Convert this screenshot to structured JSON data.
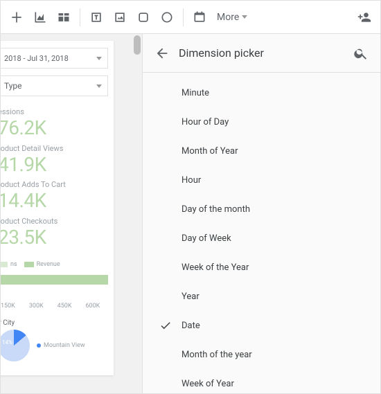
{
  "toolbar": {
    "more_label": "More"
  },
  "report": {
    "date_range": "2018 - Jul 31, 2018",
    "type_label": "Type",
    "metrics": [
      {
        "label": "essions",
        "value": "76.2K"
      },
      {
        "label": "roduct Detail Views",
        "value": "41.9K"
      },
      {
        "label": "roduct Adds To Cart",
        "value": "14.4K"
      },
      {
        "label": "roduct Checkouts",
        "value": "23.5K"
      }
    ],
    "legend": [
      "ns",
      "Revenue"
    ],
    "axis": [
      "150K",
      "300K",
      "450K",
      "600K"
    ],
    "subtitle": "y City",
    "pie_label": "14%",
    "pie_legend": "Mountain View"
  },
  "panel": {
    "title": "Dimension picker",
    "items": [
      {
        "label": "Minute",
        "selected": false
      },
      {
        "label": "Hour of Day",
        "selected": false
      },
      {
        "label": "Month of Year",
        "selected": false
      },
      {
        "label": "Hour",
        "selected": false
      },
      {
        "label": "Day of the month",
        "selected": false
      },
      {
        "label": "Day of Week",
        "selected": false
      },
      {
        "label": "Week of the Year",
        "selected": false
      },
      {
        "label": "Year",
        "selected": false
      },
      {
        "label": "Date",
        "selected": true
      },
      {
        "label": "Month of the year",
        "selected": false
      },
      {
        "label": "Week of Year",
        "selected": false
      }
    ]
  }
}
